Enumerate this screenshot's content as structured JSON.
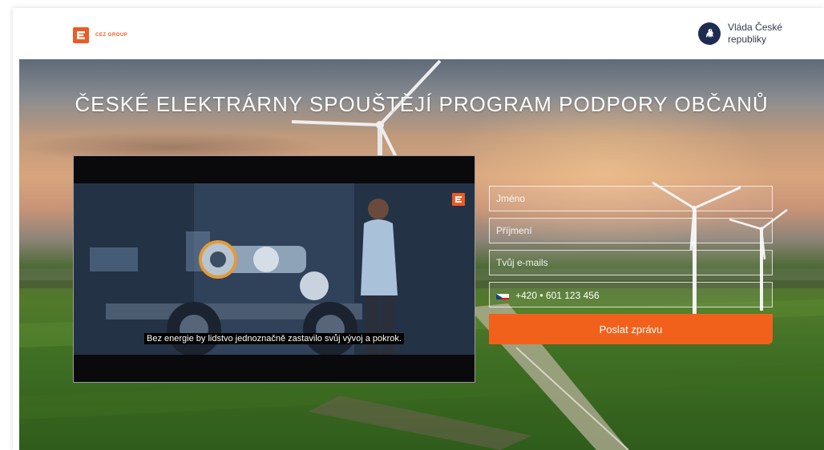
{
  "header": {
    "logo_text": "CEZ GROUP",
    "gov_line1": "Vláda České",
    "gov_line2": "republiky"
  },
  "hero": {
    "title": "ČESKÉ ELEKTRÁRNY SPOUŠTĚJÍ PROGRAM PODPORY OBČANŮ"
  },
  "video": {
    "caption": "Bez energie by lidstvo jednoznačně zastavilo svůj vývoj a pokrok."
  },
  "form": {
    "first_name_placeholder": "Jméno",
    "last_name_placeholder": "Příjmení",
    "email_placeholder": "Tvůj e-mails",
    "phone_value": "+420 • 601 123 456",
    "submit_label": "Poslat zprávu"
  },
  "colors": {
    "brand": "#f05a22",
    "button": "#f2611c",
    "gov": "#1e2d4f"
  }
}
